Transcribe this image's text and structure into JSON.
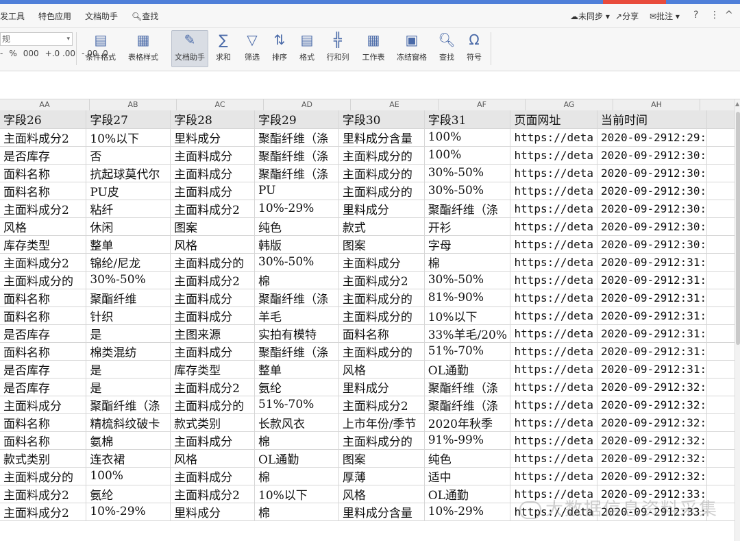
{
  "menu": {
    "items": [
      "发工具",
      "特色应用",
      "文档助手"
    ],
    "search_label": "查找",
    "sync_label": "未同步",
    "share_label": "分享",
    "comment_label": "批注",
    "help_label": "?",
    "more_label": "⋮",
    "collapse_label": "^"
  },
  "ribbon": {
    "number_format_value": "规",
    "format_buttons": [
      "%",
      "000",
      "+.0 .00",
      "-.00 .0"
    ],
    "buttons": [
      {
        "label": "条件格式",
        "icon": "conditional-format-icon"
      },
      {
        "label": "表格样式",
        "icon": "table-style-icon"
      },
      {
        "label": "文档助手",
        "icon": "doc-assistant-icon"
      },
      {
        "label": "求和",
        "icon": "sum-icon"
      },
      {
        "label": "筛选",
        "icon": "filter-icon"
      },
      {
        "label": "排序",
        "icon": "sort-icon"
      },
      {
        "label": "格式",
        "icon": "format-icon"
      },
      {
        "label": "行和列",
        "icon": "rows-columns-icon"
      },
      {
        "label": "工作表",
        "icon": "worksheet-icon"
      },
      {
        "label": "冻结窗格",
        "icon": "freeze-panes-icon"
      },
      {
        "label": "查找",
        "icon": "find-icon"
      },
      {
        "label": "符号",
        "icon": "symbol-icon"
      }
    ]
  },
  "sheet": {
    "column_letters": [
      "AA",
      "AB",
      "AC",
      "AD",
      "AE",
      "AF",
      "AG",
      "AH"
    ],
    "header_row": [
      "字段26",
      "字段27",
      "字段28",
      "字段29",
      "字段30",
      "字段31",
      "页面网址",
      "当前时间"
    ],
    "rows": [
      [
        "主面料成分2",
        "10%以下",
        "里料成分",
        "聚酯纤维（涤",
        "里料成分含量",
        "100%",
        "https://deta",
        "2020-09-2912:29:"
      ],
      [
        "是否库存",
        "否",
        "主面料成分",
        "聚酯纤维（涤",
        "主面料成分的",
        "100%",
        "https://deta",
        "2020-09-2912:30:"
      ],
      [
        "面料名称",
        "抗起球莫代尔",
        "主面料成分",
        "聚酯纤维（涤",
        "主面料成分的",
        "30%-50%",
        "https://deta",
        "2020-09-2912:30:"
      ],
      [
        "面料名称",
        "PU皮",
        "主面料成分",
        "PU",
        "主面料成分的",
        "30%-50%",
        "https://deta",
        "2020-09-2912:30:"
      ],
      [
        "主面料成分2",
        "粘纤",
        "主面料成分2",
        "10%-29%",
        "里料成分",
        "聚酯纤维（涤",
        "https://deta",
        "2020-09-2912:30:"
      ],
      [
        "风格",
        "休闲",
        "图案",
        "纯色",
        "款式",
        "开衫",
        "https://deta",
        "2020-09-2912:30:"
      ],
      [
        "库存类型",
        "整单",
        "风格",
        "韩版",
        "图案",
        "字母",
        "https://deta",
        "2020-09-2912:30:"
      ],
      [
        "主面料成分2",
        "锦纶/尼龙",
        "主面料成分的",
        "30%-50%",
        "主面料成分",
        "棉",
        "https://deta",
        "2020-09-2912:31:"
      ],
      [
        "主面料成分的",
        "30%-50%",
        "主面料成分2",
        "棉",
        "主面料成分2",
        "30%-50%",
        "https://deta",
        "2020-09-2912:31:"
      ],
      [
        "面料名称",
        "聚酯纤维",
        "主面料成分",
        "聚酯纤维（涤",
        "主面料成分的",
        "81%-90%",
        "https://deta",
        "2020-09-2912:31:"
      ],
      [
        "面料名称",
        "针织",
        "主面料成分",
        "羊毛",
        "主面料成分的",
        "10%以下",
        "https://deta",
        "2020-09-2912:31:"
      ],
      [
        "是否库存",
        "是",
        "主图来源",
        "实拍有模特",
        "面料名称",
        "33%羊毛/20%",
        "https://deta",
        "2020-09-2912:31:"
      ],
      [
        "面料名称",
        "棉类混纺",
        "主面料成分",
        "聚酯纤维（涤",
        "主面料成分的",
        "51%-70%",
        "https://deta",
        "2020-09-2912:31:"
      ],
      [
        "是否库存",
        "是",
        "库存类型",
        "整单",
        "风格",
        "OL通勤",
        "https://deta",
        "2020-09-2912:31:"
      ],
      [
        "是否库存",
        "是",
        "主面料成分2",
        "氨纶",
        "里料成分",
        "聚酯纤维（涤",
        "https://deta",
        "2020-09-2912:32:"
      ],
      [
        "主面料成分",
        "聚酯纤维（涤",
        "主面料成分的",
        "51%-70%",
        "主面料成分2",
        "聚酯纤维（涤",
        "https://deta",
        "2020-09-2912:32:"
      ],
      [
        "面料名称",
        "精梳斜纹破卡",
        "款式类别",
        "长款风衣",
        "上市年份/季节",
        "2020年秋季",
        "https://deta",
        "2020-09-2912:32:"
      ],
      [
        "面料名称",
        "氨棉",
        "主面料成分",
        "棉",
        "主面料成分的",
        "91%-99%",
        "https://deta",
        "2020-09-2912:32:"
      ],
      [
        "款式类别",
        "连衣裙",
        "风格",
        "OL通勤",
        "图案",
        "纯色",
        "https://deta",
        "2020-09-2912:32:"
      ],
      [
        "主面料成分的",
        "100%",
        "主面料成分",
        "棉",
        "厚薄",
        "适中",
        "https://deta",
        "2020-09-2912:32:"
      ],
      [
        "主面料成分2",
        "氨纶",
        "主面料成分2",
        "10%以下",
        "风格",
        "OL通勤",
        "https://deta",
        "2020-09-2912:33:"
      ],
      [
        "主面料成分2",
        "10%-29%",
        "里料成分",
        "棉",
        "里料成分含量",
        "10%-29%",
        "https://deta",
        "2020-09-2912:33:"
      ]
    ]
  },
  "watermark": {
    "text": "大数据信息资料采集"
  }
}
